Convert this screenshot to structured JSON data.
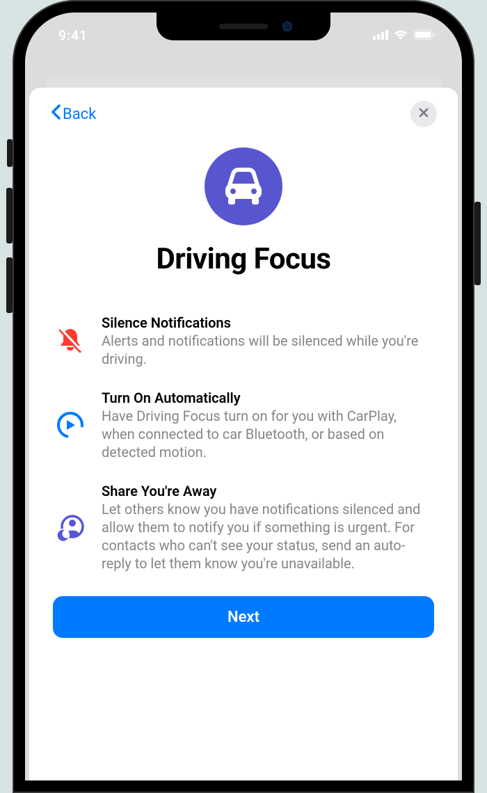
{
  "status": {
    "time": "9:41"
  },
  "nav": {
    "back_label": "Back"
  },
  "hero": {
    "title": "Driving Focus"
  },
  "features": [
    {
      "icon": "bell-slash-icon",
      "title": "Silence Notifications",
      "desc": "Alerts and notifications will be silenced while you're driving."
    },
    {
      "icon": "play-circle-icon",
      "title": "Turn On Automatically",
      "desc": "Have Driving Focus turn on for you with CarPlay, when connected to car Bluetooth, or based on detected motion."
    },
    {
      "icon": "person-moon-icon",
      "title": "Share You're Away",
      "desc": "Let others know you have notifications silenced and allow them to notify you if something is urgent. For contacts who can't see your status, send an auto-reply to let them know you're unavailable."
    }
  ],
  "cta": {
    "next_label": "Next"
  }
}
